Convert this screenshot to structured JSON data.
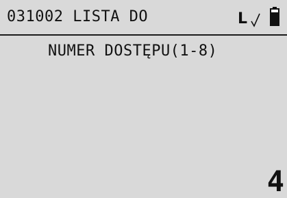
{
  "header": {
    "title": "031002 LISTA DO",
    "signal_label": "L",
    "check_icon": "check-mark-icon",
    "battery_icon": "battery-icon"
  },
  "main": {
    "prompt": "NUMER DOSTĘPU(1-8)",
    "entered_value": "4"
  },
  "colors": {
    "background": "#d9d9d9",
    "text": "#111111",
    "divider": "#1a1a1a"
  }
}
